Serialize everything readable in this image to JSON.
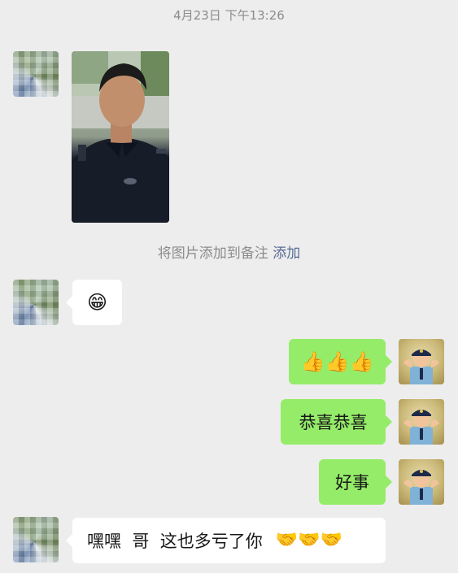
{
  "timestamp": "4月23日 下午13:26",
  "notice": {
    "text": "将图片添加到备注",
    "link": "添加"
  },
  "messages": [
    {
      "side": "left",
      "type": "image",
      "description": "selfie"
    },
    {
      "side": "left",
      "type": "emoji",
      "emoji": "😁"
    },
    {
      "side": "right",
      "type": "emoji",
      "emoji": "👍👍👍"
    },
    {
      "side": "right",
      "type": "text",
      "text": "恭喜恭喜"
    },
    {
      "side": "right",
      "type": "text",
      "text": "好事"
    },
    {
      "side": "left",
      "type": "text",
      "text": "嘿嘿  哥  这也多亏了你",
      "emoji": "🤝🤝🤝"
    }
  ],
  "colors": {
    "background": "#ededed",
    "bubble_white": "#ffffff",
    "bubble_green": "#95ec69",
    "link": "#576b95",
    "meta_text": "#8c8c8c"
  }
}
